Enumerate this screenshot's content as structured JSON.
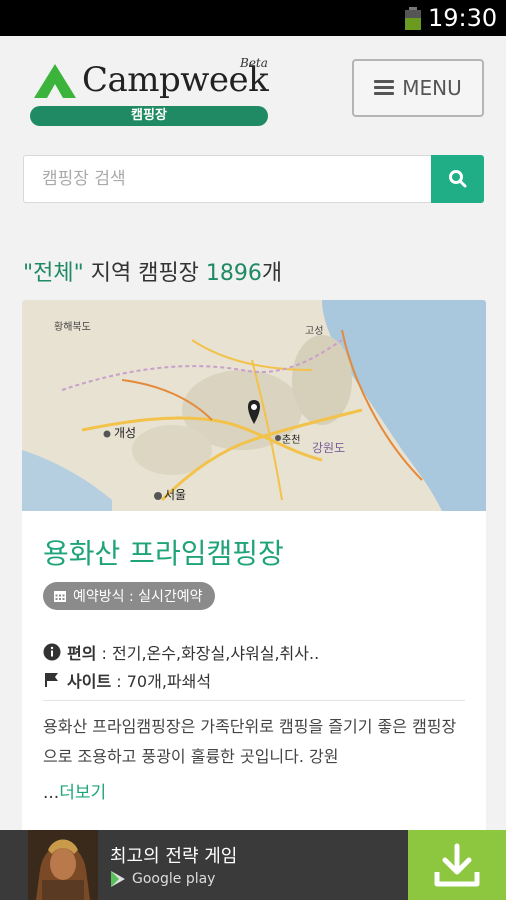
{
  "status_bar": {
    "time": "19:30"
  },
  "header": {
    "logo_text": "Campweek",
    "logo_beta": "Beta",
    "logo_sub": "캠핑장",
    "menu_label": "MENU"
  },
  "search": {
    "placeholder": "캠핑장 검색"
  },
  "result": {
    "open_quote": "\"",
    "region": "전체",
    "close_quote": "\"",
    "middle": " 지역 캠핑장 ",
    "count": "1896",
    "unit": "개"
  },
  "card": {
    "map_labels": [
      "황해북도",
      "개성",
      "서울",
      "춘천",
      "강원도",
      "고성"
    ],
    "name": "용화산 프라임캠핑장",
    "booking": "예약방식 : 실시간예약",
    "facilities_label": "편의",
    "facilities_value": " : 전기,온수,화장실,샤워실,취사..",
    "site_label": "사이트",
    "site_value": " : 70개,파쇄석",
    "description": "용화산 프라임캠핑장은 가족단위로 캠핑을 즐기기 좋은 캠핑장으로 조용하고 풍광이 훌륭한 곳입니다. 강원",
    "more_prefix": "...",
    "more_label": "더보기"
  },
  "ad": {
    "title": "최고의 전략 게임",
    "store": "Google play"
  },
  "colors": {
    "brand": "#1f8a63",
    "accent": "#1fae86",
    "ad_download": "#8dc63f"
  }
}
